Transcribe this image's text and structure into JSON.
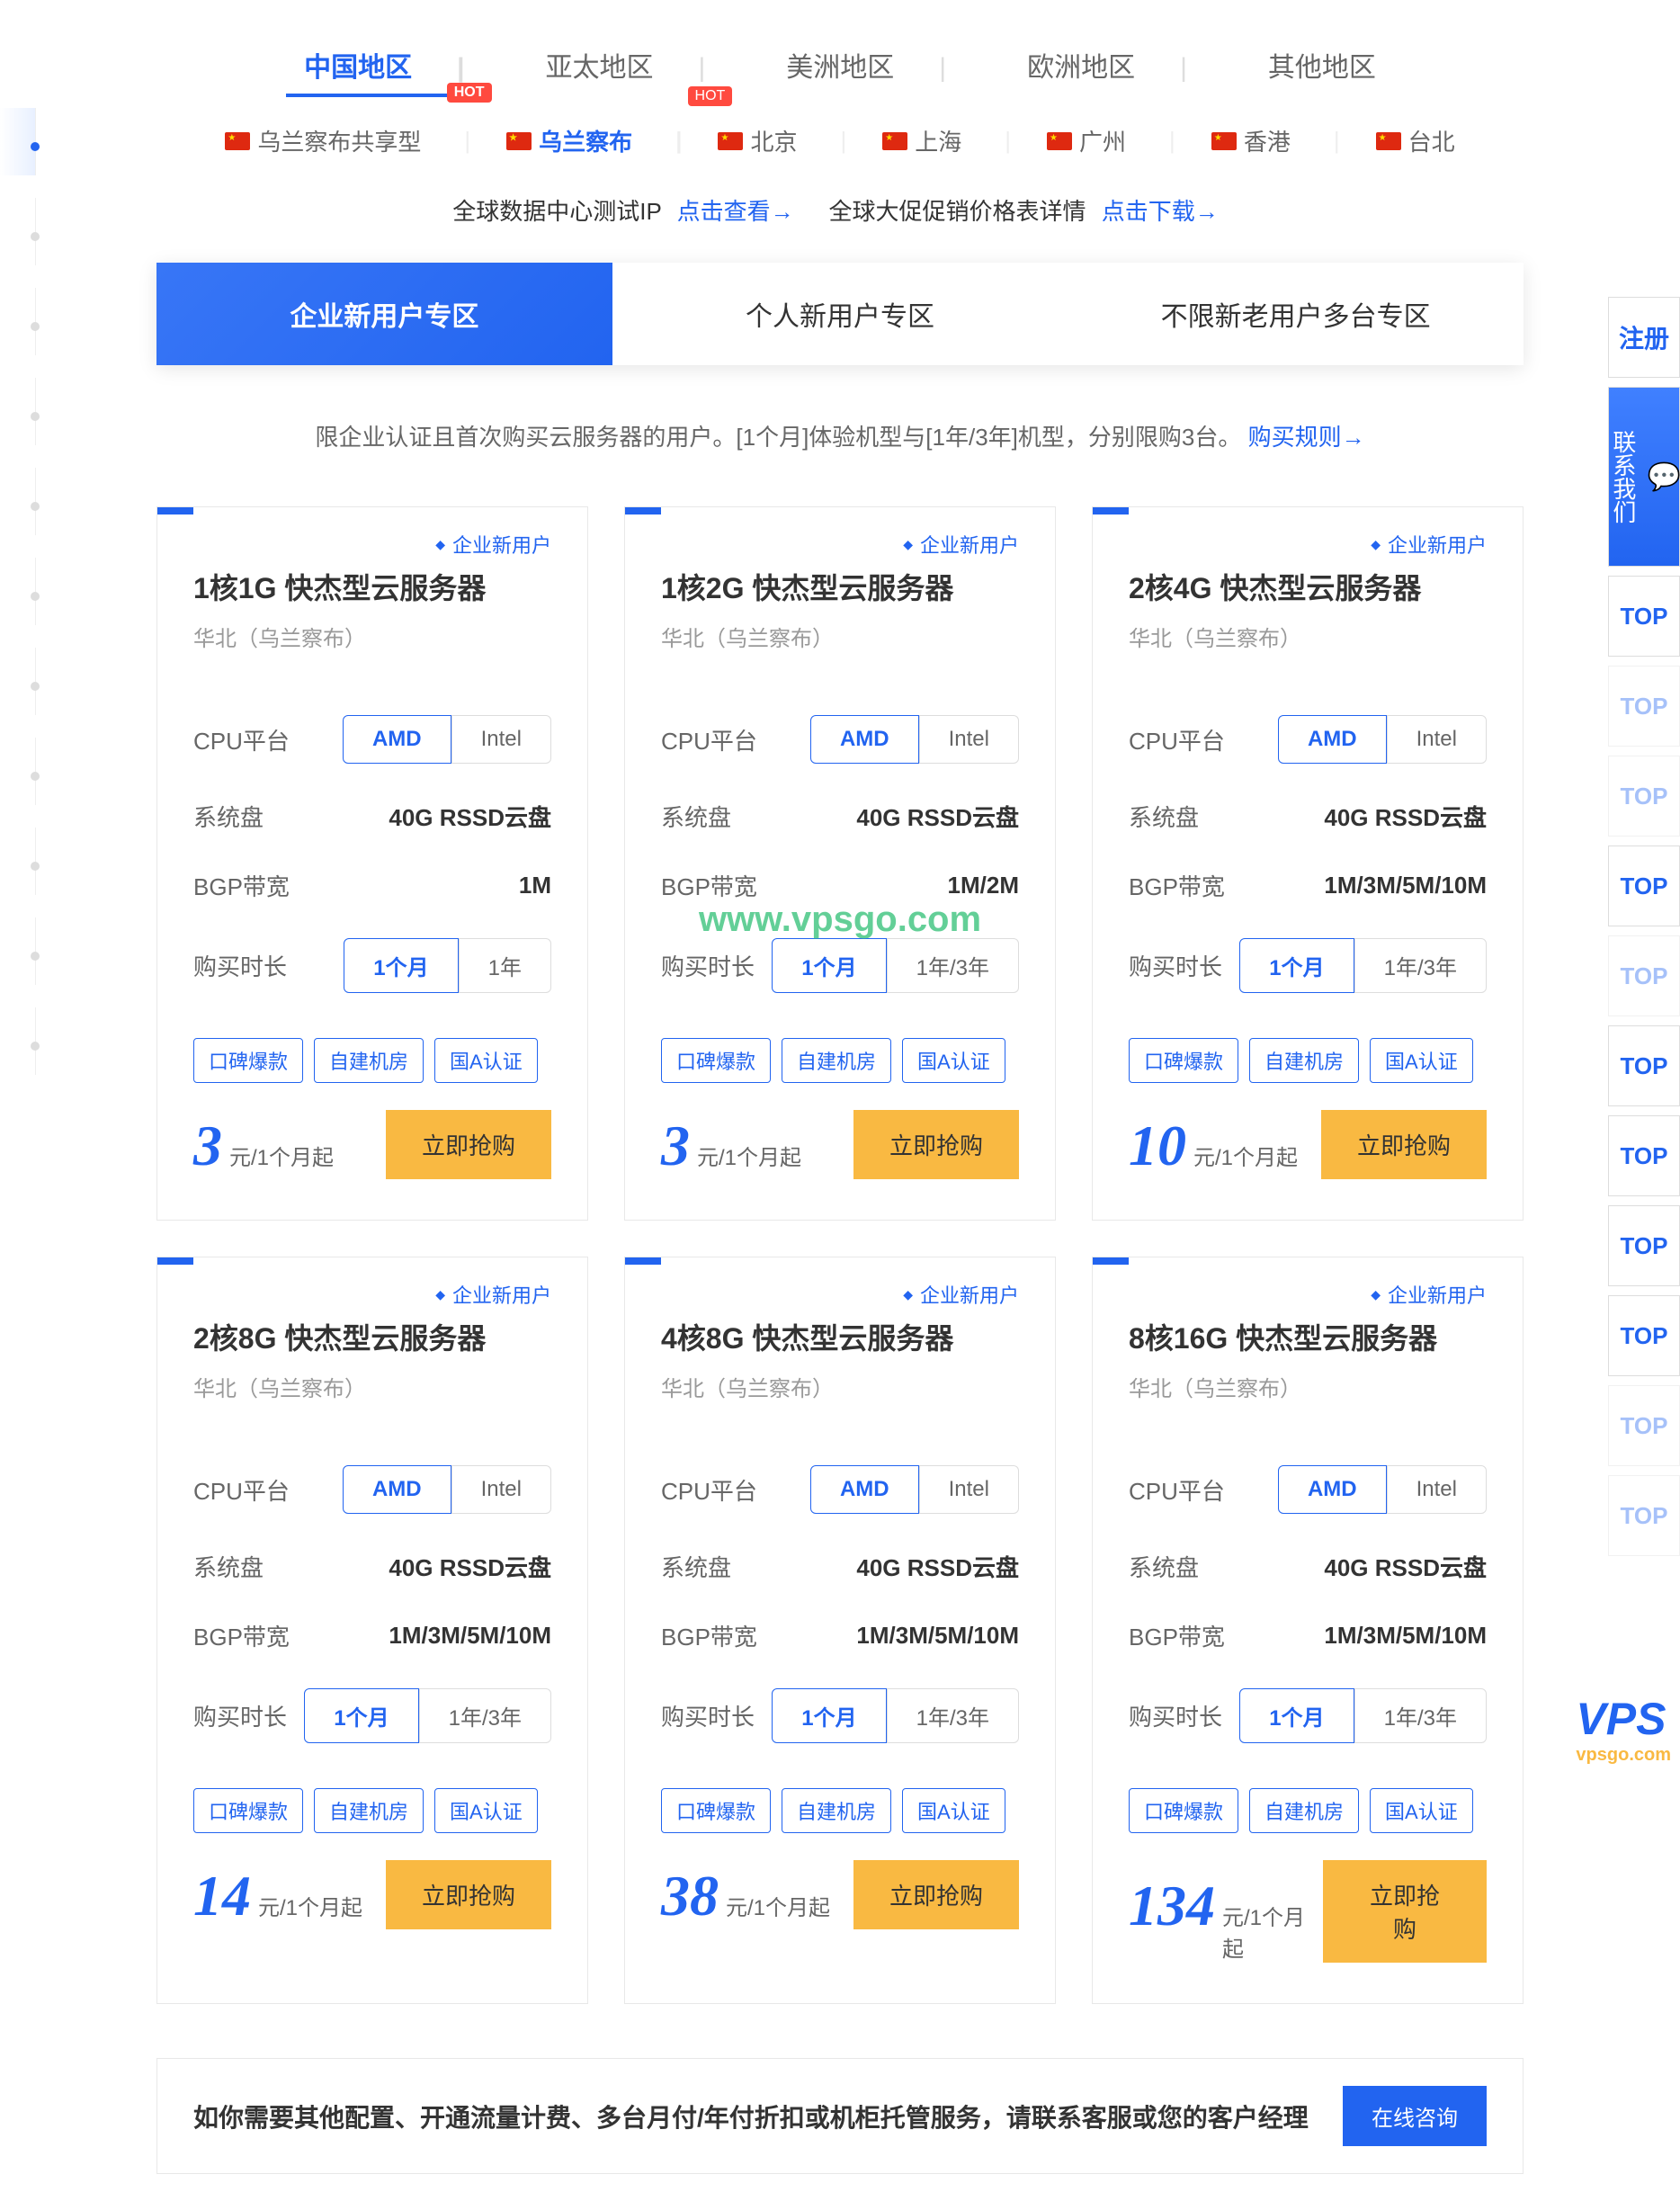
{
  "regions": [
    {
      "label": "中国地区",
      "active": true,
      "hot": true
    },
    {
      "label": "亚太地区",
      "active": false,
      "hot": true
    },
    {
      "label": "美洲地区",
      "active": false
    },
    {
      "label": "欧洲地区",
      "active": false
    },
    {
      "label": "其他地区",
      "active": false
    }
  ],
  "cities": [
    {
      "label": "乌兰察布共享型",
      "active": false
    },
    {
      "label": "乌兰察布",
      "active": true
    },
    {
      "label": "北京",
      "active": false
    },
    {
      "label": "上海",
      "active": false
    },
    {
      "label": "广州",
      "active": false
    },
    {
      "label": "香港",
      "active": false
    },
    {
      "label": "台北",
      "active": false
    }
  ],
  "info": {
    "text1": "全球数据中心测试IP",
    "link1": "点击查看→",
    "text2": "全球大促促销价格表详情",
    "link2": "点击下载→"
  },
  "user_tabs": [
    {
      "label": "企业新用户专区",
      "active": true
    },
    {
      "label": "个人新用户专区",
      "active": false
    },
    {
      "label": "不限新老用户多台专区",
      "active": false
    }
  ],
  "notice": {
    "text": "限企业认证且首次购买云服务器的用户。[1个月]体验机型与[1年/3年]机型，分别限购3台。",
    "link": "购买规则→"
  },
  "badge_label": "企业新用户",
  "spec_labels": {
    "cpu": "CPU平台",
    "disk": "系统盘",
    "bgp": "BGP带宽",
    "duration": "购买时长"
  },
  "cpu_options": [
    "AMD",
    "Intel"
  ],
  "tags": [
    "口碑爆款",
    "自建机房",
    "国A认证"
  ],
  "buy_btn": "立即抢购",
  "cards": [
    {
      "title": "1核1G 快杰型云服务器",
      "subtitle": "华北（乌兰察布）",
      "disk": "40G RSSD云盘",
      "bgp": "1M",
      "durations": [
        "1个月",
        "1年"
      ],
      "price": "3",
      "unit": "元/1个月起"
    },
    {
      "title": "1核2G 快杰型云服务器",
      "subtitle": "华北（乌兰察布）",
      "disk": "40G RSSD云盘",
      "bgp": "1M/2M",
      "durations": [
        "1个月",
        "1年/3年"
      ],
      "price": "3",
      "unit": "元/1个月起"
    },
    {
      "title": "2核4G 快杰型云服务器",
      "subtitle": "华北（乌兰察布）",
      "disk": "40G RSSD云盘",
      "bgp": "1M/3M/5M/10M",
      "durations": [
        "1个月",
        "1年/3年"
      ],
      "price": "10",
      "unit": "元/1个月起"
    },
    {
      "title": "2核8G 快杰型云服务器",
      "subtitle": "华北（乌兰察布）",
      "disk": "40G RSSD云盘",
      "bgp": "1M/3M/5M/10M",
      "durations": [
        "1个月",
        "1年/3年"
      ],
      "price": "14",
      "unit": "元/1个月起"
    },
    {
      "title": "4核8G 快杰型云服务器",
      "subtitle": "华北（乌兰察布）",
      "disk": "40G RSSD云盘",
      "bgp": "1M/3M/5M/10M",
      "durations": [
        "1个月",
        "1年/3年"
      ],
      "price": "38",
      "unit": "元/1个月起"
    },
    {
      "title": "8核16G 快杰型云服务器",
      "subtitle": "华北（乌兰察布）",
      "disk": "40G RSSD云盘",
      "bgp": "1M/3M/5M/10M",
      "durations": [
        "1个月",
        "1年/3年"
      ],
      "price": "134",
      "unit": "元/1个月起"
    }
  ],
  "bottom": {
    "text": "如你需要其他配置、开通流量计费、多台月付/年付折扣或机柜托管服务，请联系客服或您的客户经理",
    "btn": "在线咨询"
  },
  "side": {
    "register": "注册",
    "contact": "联系我们",
    "top": "TOP"
  },
  "watermark": "www.vpsgo.com",
  "logo": "VPS",
  "logo_sub": "vpsgo.com"
}
